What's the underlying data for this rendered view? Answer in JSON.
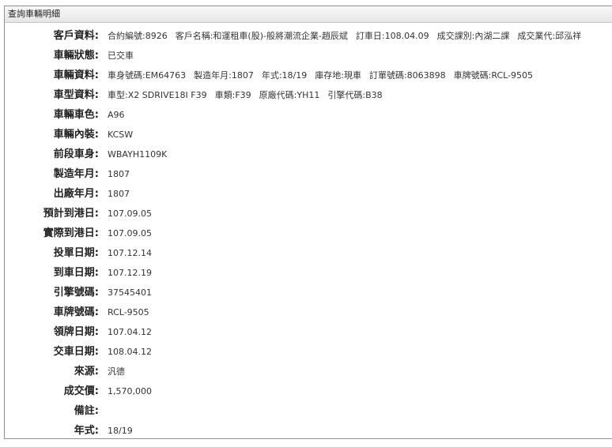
{
  "panel": {
    "title": "查詢車輛明細"
  },
  "rows": [
    {
      "label": "客戶資料:",
      "segments": [
        "合約編號:8926",
        "客戶名稱:和運租車(股)-般將潮流企業-趙辰斌",
        "訂車日:108.04.09",
        "成交課別:內湖二課",
        "成交業代:邱泓祥"
      ]
    },
    {
      "label": "車輛狀態:",
      "segments": [
        "已交車"
      ]
    },
    {
      "label": "車輛資料:",
      "segments": [
        "車身號碼:EM64763",
        "製造年月:1807",
        "年式:18/19",
        "庫存地:現車",
        "訂單號碼:8063898",
        "車牌號碼:RCL-9505"
      ]
    },
    {
      "label": "車型資料:",
      "segments": [
        "車型:X2 SDRIVE18I F39",
        "車類:F39",
        "原廠代碼:YH11",
        "引擎代碼:B38"
      ]
    },
    {
      "label": "車輛車色:",
      "segments": [
        "A96"
      ]
    },
    {
      "label": "車輛內裝:",
      "segments": [
        "KCSW"
      ]
    },
    {
      "label": "前段車身:",
      "segments": [
        "WBAYH1109K"
      ]
    },
    {
      "label": "製造年月:",
      "segments": [
        "1807"
      ]
    },
    {
      "label": "出廠年月:",
      "segments": [
        "1807"
      ]
    },
    {
      "label": "預計到港日:",
      "segments": [
        "107.09.05"
      ]
    },
    {
      "label": "實際到港日:",
      "segments": [
        "107.09.05"
      ]
    },
    {
      "label": "投單日期:",
      "segments": [
        "107.12.14"
      ]
    },
    {
      "label": "到車日期:",
      "segments": [
        "107.12.19"
      ]
    },
    {
      "label": "引擎號碼:",
      "segments": [
        "37545401"
      ]
    },
    {
      "label": "車牌號碼:",
      "segments": [
        "RCL-9505"
      ]
    },
    {
      "label": "領牌日期:",
      "segments": [
        "107.04.12"
      ]
    },
    {
      "label": "交車日期:",
      "segments": [
        "108.04.12"
      ]
    },
    {
      "label": "來源:",
      "segments": [
        "汎德"
      ]
    },
    {
      "label": "成交價:",
      "segments": [
        "1,570,000"
      ]
    },
    {
      "label": "備註:",
      "segments": [
        ""
      ]
    },
    {
      "label": "年式:",
      "segments": [
        "18/19"
      ]
    }
  ]
}
